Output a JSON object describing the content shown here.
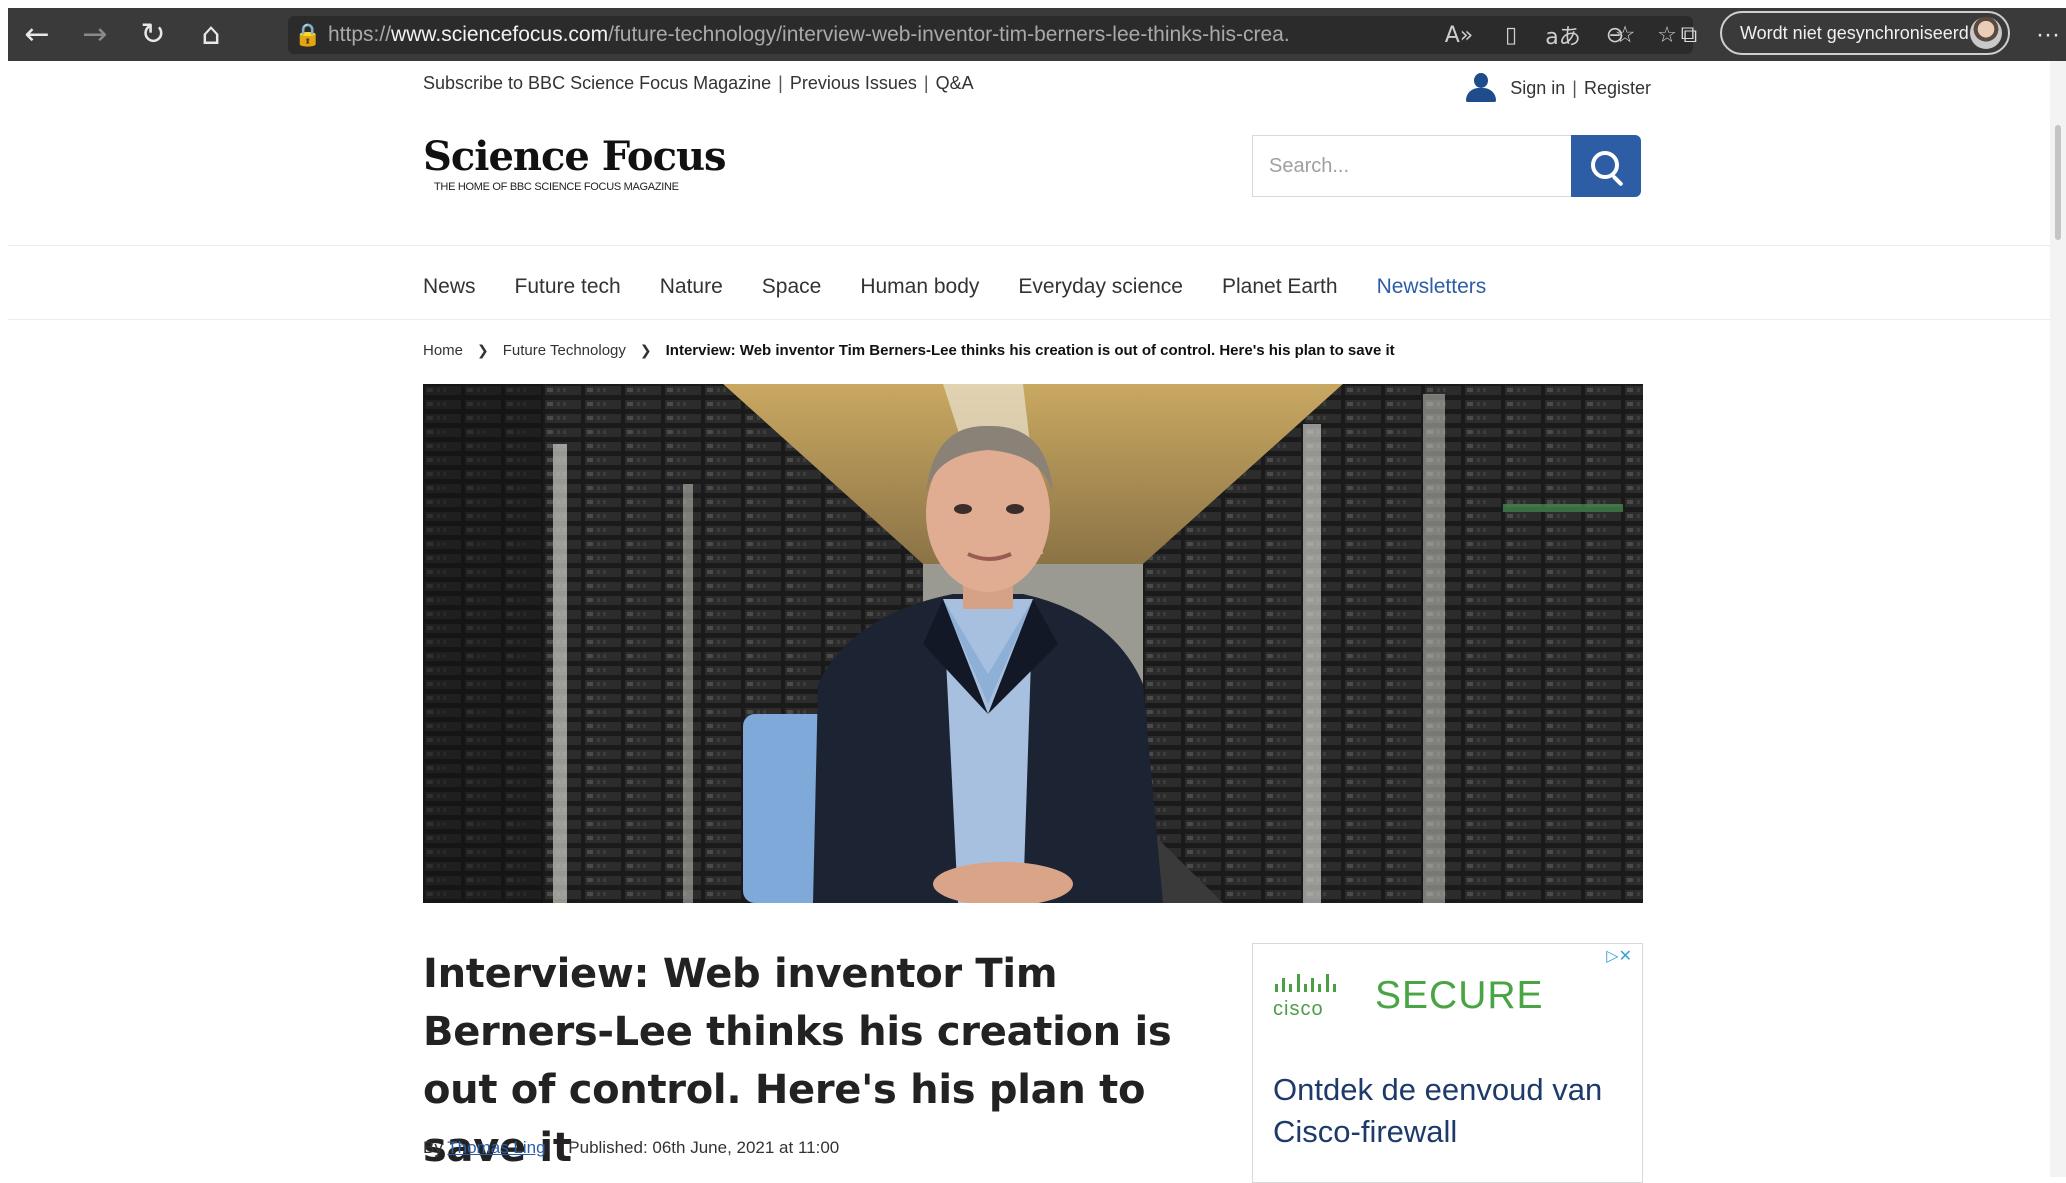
{
  "browser": {
    "url_prefix": "https://",
    "url_host": "www.sciencefocus.com",
    "url_path": "/future-technology/interview-web-inventor-tim-berners-lee-thinks-his-crea...",
    "sync_status": "Wordt niet gesynchroniseerd",
    "icons": {
      "back": "←",
      "forward": "→",
      "refresh": "↻",
      "home": "⌂",
      "lock": "🔒",
      "read_aloud": "A»",
      "immersive_reader": "▯",
      "translate": "aあ",
      "zoom": "⊖",
      "add_favorite": "☆",
      "favorites": "☆",
      "collections": "⧉",
      "more": "···"
    }
  },
  "site": {
    "topbar": {
      "subscribe": "Subscribe to BBC Science Focus Magazine",
      "previous_issues": "Previous Issues",
      "qa": "Q&A",
      "separator": "|",
      "sign_in": "Sign in",
      "register": "Register"
    },
    "logo": "Science Focus",
    "tagline": "THE HOME OF BBC SCIENCE FOCUS MAGAZINE",
    "search_placeholder": "Search...",
    "nav": [
      "News",
      "Future tech",
      "Nature",
      "Space",
      "Human body",
      "Everyday science",
      "Planet Earth",
      "Newsletters"
    ],
    "accent_color": "#2d5ea5"
  },
  "breadcrumb": {
    "home": "Home",
    "section": "Future Technology",
    "current": "Interview: Web inventor Tim Berners-Lee thinks his creation is out of control. Here's his plan to save it"
  },
  "article": {
    "title": "Interview: Web inventor Tim Berners-Lee thinks his creation is out of control. Here's his plan to save it",
    "by": "By",
    "author": "Thomas Ling",
    "published": "Published: 06th June, 2021 at 11:00"
  },
  "ad": {
    "flags": "▷✕",
    "brand": "cisco",
    "headline": "SECURE",
    "text": "Ontdek de eenvoud van Cisco-firewall",
    "brand_color": "#49a443"
  }
}
